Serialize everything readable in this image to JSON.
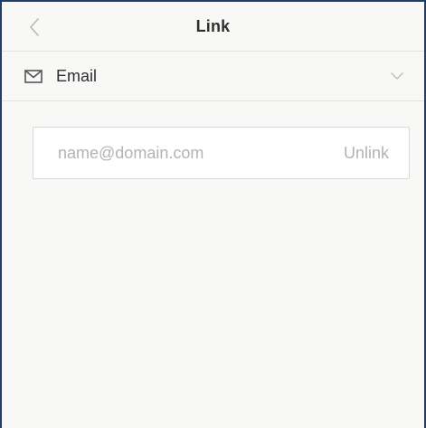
{
  "header": {
    "title": "Link",
    "back_icon": "chevron-left-icon"
  },
  "link_type": {
    "label": "Email",
    "icon": "envelope-icon",
    "dropdown_icon": "chevron-down-icon"
  },
  "email_field": {
    "value": "",
    "placeholder": "name@domain.com"
  },
  "unlink_label": "Unlink",
  "colors": {
    "frame_border": "#1f3f6a",
    "background": "#f8f8f7",
    "divider": "#e3e3e3",
    "placeholder_text": "#b3b3b3",
    "primary_text": "#2f2f2f"
  }
}
